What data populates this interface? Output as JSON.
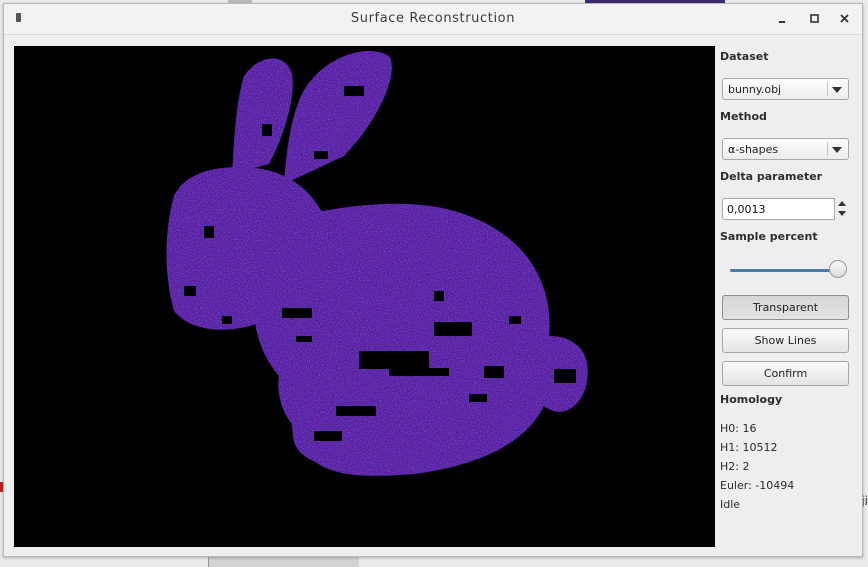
{
  "window": {
    "title": "Surface Reconstruction"
  },
  "panel": {
    "dataset_label": "Dataset",
    "dataset_value": "bunny.obj",
    "method_label": "Method",
    "method_value": "α-shapes",
    "delta_label": "Delta parameter",
    "delta_value": "0,0013",
    "sample_label": "Sample percent",
    "sample_value": 1.0,
    "transparent_label": "Transparent",
    "show_lines_label": "Show Lines",
    "confirm_label": "Confirm",
    "homology_label": "Homology",
    "h0": "H0: 16",
    "h1": "H1: 10512",
    "h2": "H2: 2",
    "euler": "Euler: -10494",
    "status": "Idle"
  },
  "colors": {
    "viewport_bg": "#000000",
    "mesh_primary": "#5a1fa0",
    "mesh_secondary": "#3a2aa8",
    "accent": "#4a7aa8"
  }
}
